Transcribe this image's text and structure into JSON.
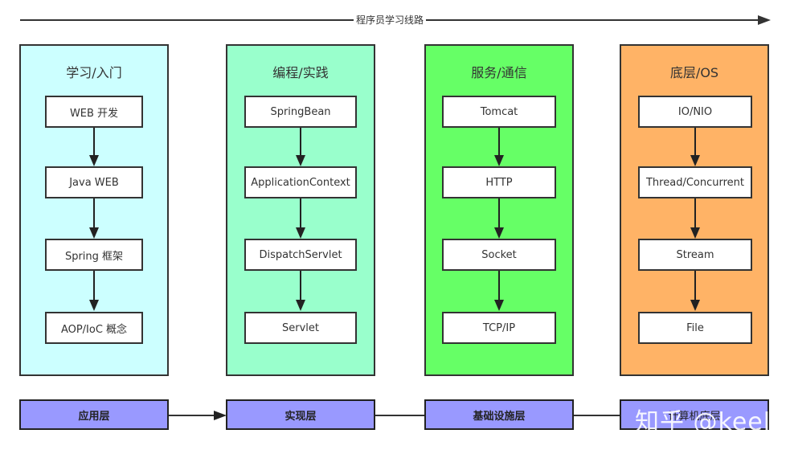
{
  "timeline": {
    "label": "程序员学习线路"
  },
  "columns": [
    {
      "title": "学习/入门",
      "color": "#ccffff",
      "nodes": [
        "WEB 开发",
        "Java WEB",
        "Spring 框架",
        "AOP/IoC 概念"
      ]
    },
    {
      "title": "编程/实践",
      "color": "#99ffcc",
      "nodes": [
        "SpringBean",
        "ApplicationContext",
        "DispatchServlet",
        "Servlet"
      ]
    },
    {
      "title": "服务/通信",
      "color": "#66ff66",
      "nodes": [
        "Tomcat",
        "HTTP",
        "Socket",
        "TCP/IP"
      ]
    },
    {
      "title": "底层/OS",
      "color": "#ffb366",
      "nodes": [
        "IO/NIO",
        "Thread/Concurrent",
        "Stream",
        "File"
      ]
    }
  ],
  "layers": [
    "应用层",
    "实现层",
    "基础设施层",
    "计算机底层"
  ],
  "layer_color": "#9999ff",
  "watermark": "知乎 @keelii"
}
